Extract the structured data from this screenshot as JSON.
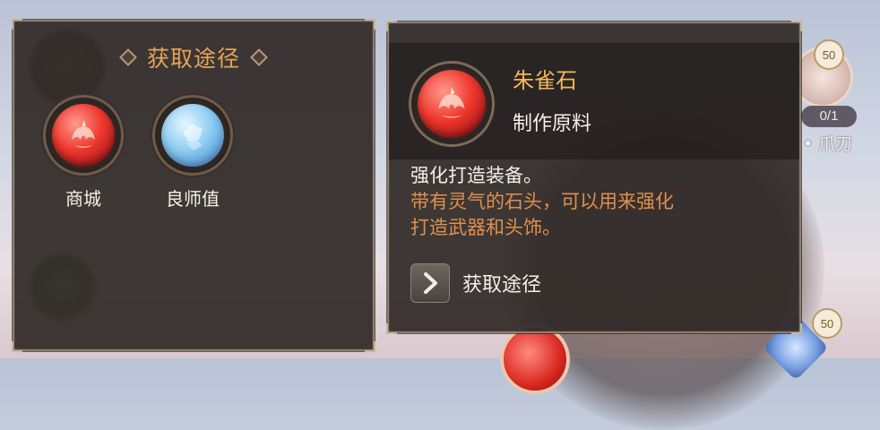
{
  "colors": {
    "panel_bg": "#302a28",
    "header_accent": "#e5a257",
    "item_name": "#f1b85d",
    "flavor_text": "#e0904d",
    "body_text": "#f4f0ea"
  },
  "source_panel": {
    "title": "获取途径",
    "sources": [
      {
        "label": "商城",
        "icon": "red-phoenix-orb-icon"
      },
      {
        "label": "良师值",
        "icon": "blue-crystal-orb-icon"
      }
    ]
  },
  "item_panel": {
    "name": "朱雀石",
    "type": "制作原料",
    "icon": "red-phoenix-orb-icon",
    "description_main": "强化打造装备。",
    "description_flavor_line1": "带有灵气的石头，可以用来强化",
    "description_flavor_line2": "打造武器和头饰。",
    "action_label": "获取途径",
    "action_icon": "chevron-right-icon"
  },
  "background": {
    "badge_top": "50",
    "badge_bottom": "50",
    "count": "0/1",
    "item_label": "• 爪刃"
  }
}
